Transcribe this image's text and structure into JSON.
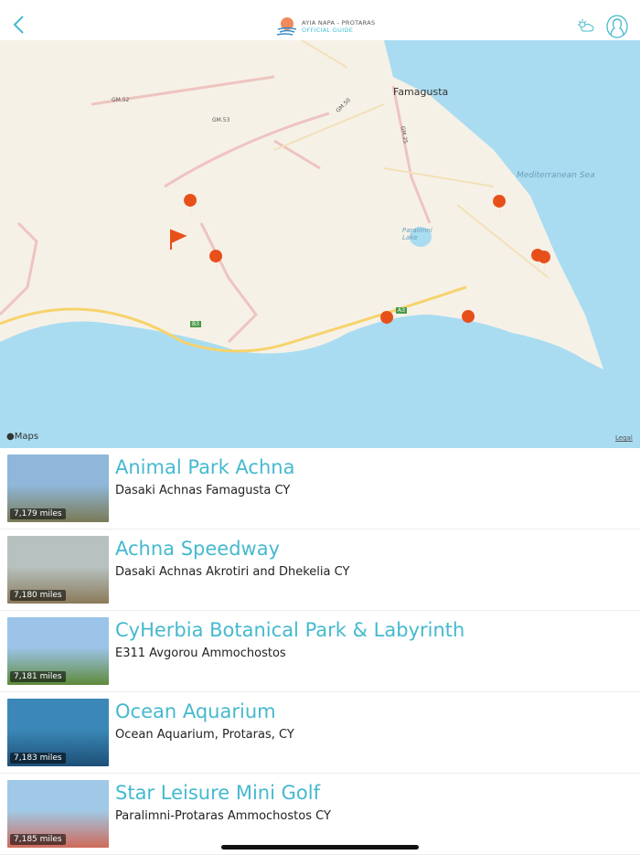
{
  "header": {
    "logo_line1": "AYIA NAPA - PROTARAS",
    "logo_line2": "OFFICIAL GUIDE"
  },
  "map": {
    "labels": {
      "famagusta": "Famagusta",
      "sea": "Mediterranean Sea",
      "lake": "Paralimni Lake",
      "gm52": "GM.52",
      "gm53": "GM.53",
      "gm50": "GM.50",
      "gm25": "GM.25",
      "b3": "B3",
      "a3": "A3"
    },
    "attribution": "Maps",
    "legal": "Legal"
  },
  "colors": {
    "accent": "#45b9cf",
    "pin": "#e8501a",
    "sea": "#a9dcf1"
  },
  "places": [
    {
      "name": "Animal Park Achna",
      "address": "Dasaki Achnas Famagusta CY",
      "distance": "7,179 miles",
      "c1": "#8fb7d9",
      "c2": "#7a7a55"
    },
    {
      "name": "Achna Speedway",
      "address": "Dasaki Achnas Akrotiri and Dhekelia CY",
      "distance": "7,180 miles",
      "c1": "#b7c2c0",
      "c2": "#8a7a5a"
    },
    {
      "name": "CyHerbia Botanical Park & Labyrinth",
      "address": "E311 Avgorou Ammochostos",
      "distance": "7,181 miles",
      "c1": "#9cc4e8",
      "c2": "#5f8a3a"
    },
    {
      "name": "Ocean Aquarium",
      "address": "Ocean Aquarium, Protaras, CY",
      "distance": "7,183 miles",
      "c1": "#3b88b8",
      "c2": "#1d4f76"
    },
    {
      "name": "Star Leisure Mini Golf",
      "address": "Paralimni-Protaras Ammochostos CY",
      "distance": "7,185 miles",
      "c1": "#9fc9e6",
      "c2": "#cf6a5a"
    }
  ]
}
